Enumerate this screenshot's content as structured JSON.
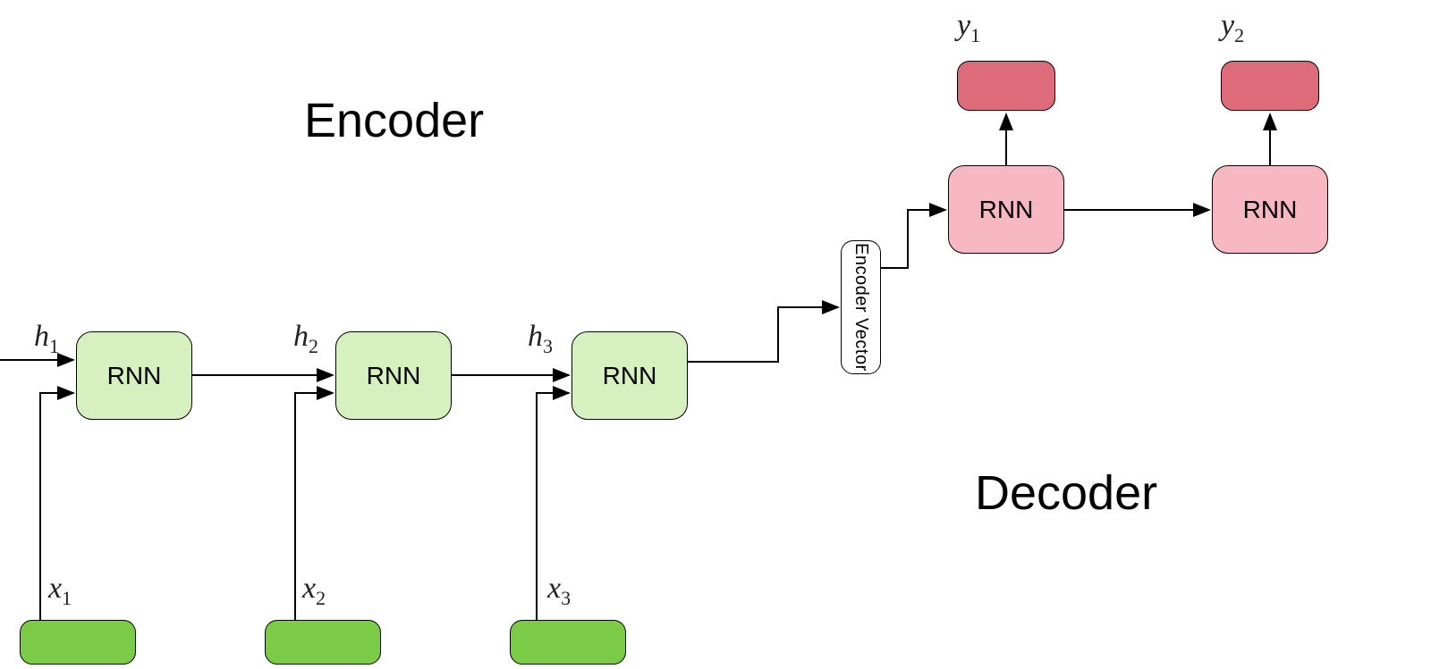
{
  "titles": {
    "encoder": "Encoder",
    "decoder": "Decoder"
  },
  "encoder": {
    "rnn_label": "RNN",
    "vector_label": "Encoder Vector",
    "hidden_states": [
      "h",
      "h",
      "h"
    ],
    "hidden_subscripts": [
      "1",
      "2",
      "3"
    ],
    "inputs": [
      "x",
      "x",
      "x"
    ],
    "input_subscripts": [
      "1",
      "2",
      "3"
    ]
  },
  "decoder": {
    "rnn_label": "RNN",
    "outputs": [
      "y",
      "y"
    ],
    "output_subscripts": [
      "1",
      "2"
    ]
  },
  "colors": {
    "encoder_rnn_fill": "#d6f0c0",
    "encoder_input_fill": "#7bcb47",
    "decoder_rnn_fill": "#f7b8c4",
    "decoder_output_fill": "#dd6b79",
    "stroke": "#000000"
  }
}
